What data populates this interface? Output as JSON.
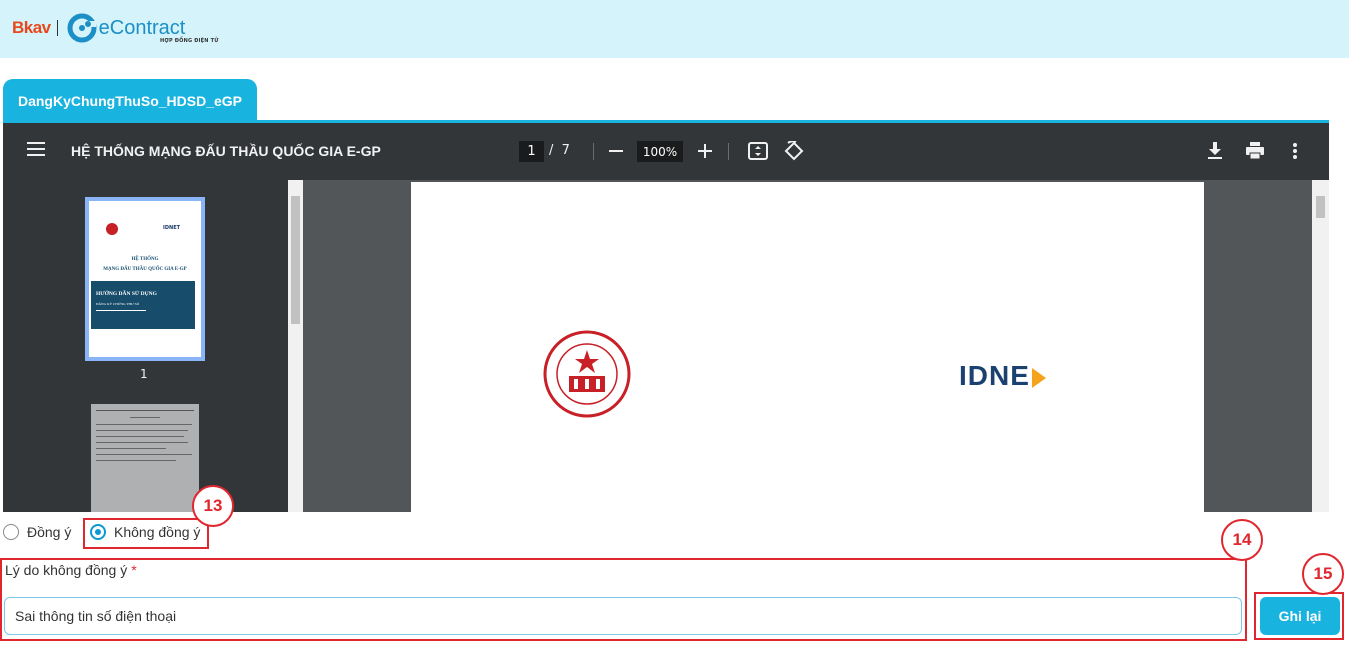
{
  "brand": {
    "bkav": "Bkav",
    "product": "eContract",
    "tagline": "HỢP ĐỒNG ĐIỆN TỬ"
  },
  "document_tab": {
    "label": "DangKyChungThuSo_HDSD_eGP"
  },
  "pdf_viewer": {
    "title": "HỆ THỐNG MẠNG ĐẤU THẦU QUỐC GIA E-GP",
    "current_page": "1",
    "page_separator": "/",
    "total_pages": "7",
    "zoom": "100%",
    "icons": [
      "menu-icon",
      "zoom-out-icon",
      "zoom-in-icon",
      "fit-page-icon",
      "rotate-icon",
      "download-icon",
      "print-icon",
      "more-icon"
    ],
    "thumbnails": [
      {
        "page_label": "1",
        "heading_1": "HỆ THỐNG",
        "heading_2": "MẠNG ĐẤU THẦU QUỐC GIA E-GP",
        "box_title": "HƯỚNG DẪN SỬ DỤNG",
        "box_subtitle": "ĐĂNG KÝ CHỨNG THƯ SỐ",
        "brand": "IDNET"
      }
    ],
    "page_content": {
      "right_logo": "IDNE"
    }
  },
  "consent": {
    "options": [
      {
        "label": "Đồng ý",
        "selected": false
      },
      {
        "label": "Không đồng ý",
        "selected": true
      }
    ]
  },
  "reason": {
    "label": "Lý do không đồng ý",
    "required_mark": "*",
    "value": "Sai thông tin số điện thoại"
  },
  "actions": {
    "save_label": "Ghi lại"
  },
  "annotations": {
    "step_13": "13",
    "step_14": "14",
    "step_15": "15"
  },
  "colors": {
    "accent": "#19b3e0",
    "header_bg": "#d4f3fb",
    "callout": "#e0262e",
    "viewer_toolbar": "#323639"
  }
}
